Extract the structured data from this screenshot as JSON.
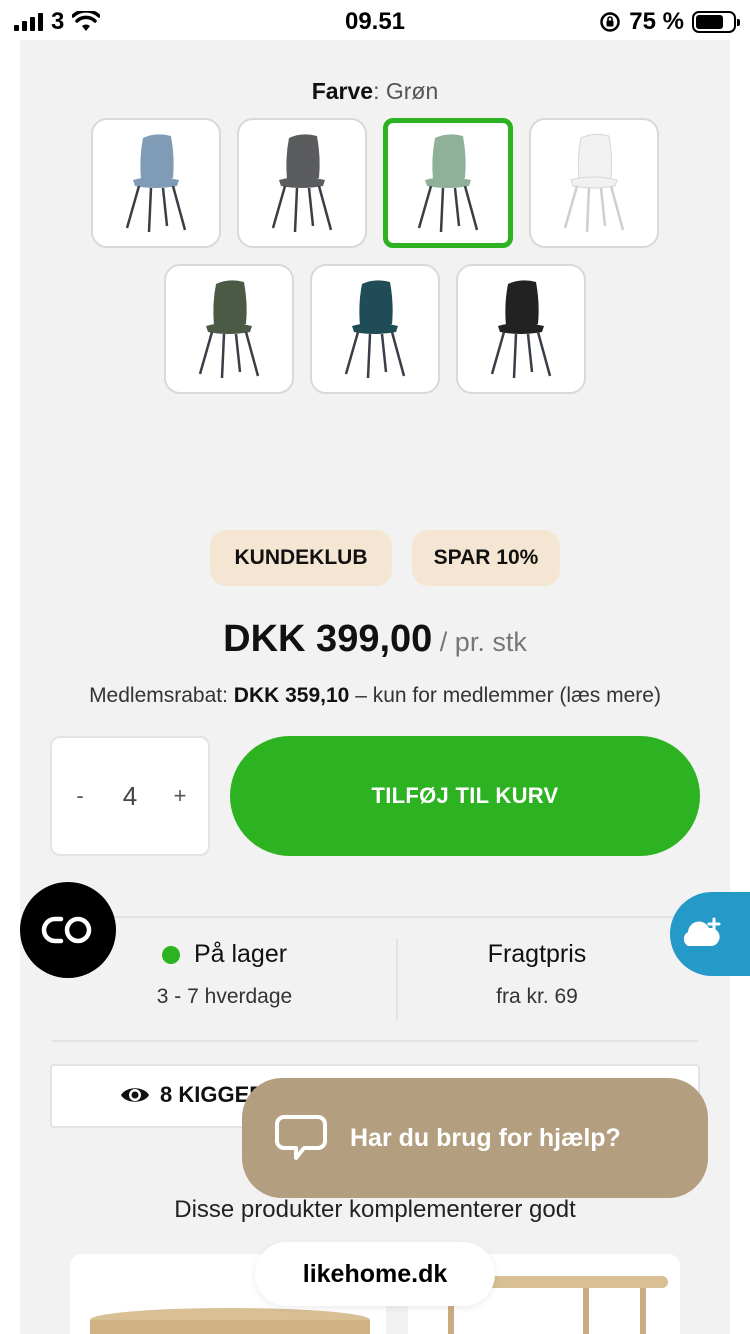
{
  "status_bar": {
    "carrier": "3",
    "time": "09.51",
    "battery": "75 %"
  },
  "product": {
    "color_label": "Farve",
    "color_value": ": Grøn",
    "swatches": [
      {
        "name": "blue-grey",
        "color": "#7f9bb5",
        "selected": false
      },
      {
        "name": "dark-grey",
        "color": "#5b5c5e",
        "selected": false
      },
      {
        "name": "green",
        "color": "#8fb19a",
        "selected": true
      },
      {
        "name": "white",
        "color": "#f1f1f1",
        "selected": false
      },
      {
        "name": "olive",
        "color": "#4b5a44",
        "selected": false
      },
      {
        "name": "petrol",
        "color": "#1f4c57",
        "selected": false
      },
      {
        "name": "black",
        "color": "#222222",
        "selected": false
      }
    ],
    "badges": [
      "KUNDEKLUB",
      "SPAR 10%"
    ],
    "price": "DKK 399,00",
    "price_unit": " / pr. stk",
    "member_prefix": "Medlemsrabat: ",
    "member_price": "DKK 359,10",
    "member_suffix": " – kun for medlemmer (læs mere)",
    "quantity": {
      "minus": "-",
      "value": "4",
      "plus": "+"
    },
    "add_to_cart": "TILFØJ TIL KURV",
    "stock": {
      "title": "På lager",
      "delivery": "3 - 7 hverdage"
    },
    "freight": {
      "title": "Fragtpris",
      "price": "fra kr. 69"
    },
    "viewers": "8 KIGGER"
  },
  "complement_title": "Disse produkter komplementerer godt",
  "help_text": "Har du brug for hjælp?",
  "domain": "likehome.dk",
  "colors": {
    "accent_green": "#2db321",
    "badge_bg": "#f5e6d3",
    "help_bg": "#b39f7f",
    "cloud_blue": "#2599c8"
  }
}
